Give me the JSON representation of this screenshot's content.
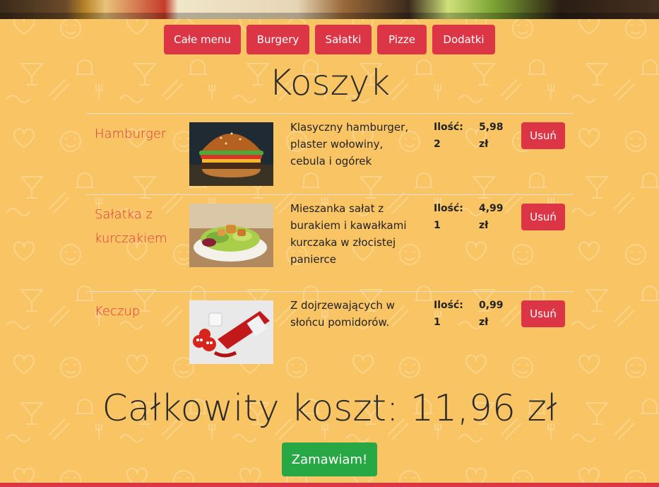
{
  "nav": {
    "items": [
      {
        "label": "Całe menu"
      },
      {
        "label": "Burgery"
      },
      {
        "label": "Sałatki"
      },
      {
        "label": "Pizze"
      },
      {
        "label": "Dodatki"
      }
    ]
  },
  "cart": {
    "title": "Koszyk",
    "items": [
      {
        "name": "Hamburger",
        "description": "Klasyczny hamburger, plaster wołowiny, cebula i ogórek",
        "qty_label": "Ilość:",
        "qty": "2",
        "price": "5,98",
        "currency": "zł",
        "remove_label": "Usuń"
      },
      {
        "name": "Sałatka z kurczakiem",
        "description": "Mieszanka sałat z burakiem i kawałkami kurczaka w złocistej panierce",
        "qty_label": "Ilość:",
        "qty": "1",
        "price": "4,99",
        "currency": "zł",
        "remove_label": "Usuń"
      },
      {
        "name": "Keczup",
        "description": "Z dojrzewających w słońcu pomidorów.",
        "qty_label": "Ilość:",
        "qty": "1",
        "price": "0,99",
        "currency": "zł",
        "remove_label": "Usuń"
      }
    ],
    "total": "Całkowity koszt: 11,96 zł",
    "order_label": "Zamawiam!"
  },
  "colors": {
    "background": "#f9c463",
    "accent": "#dc3545",
    "success": "#28a745"
  }
}
